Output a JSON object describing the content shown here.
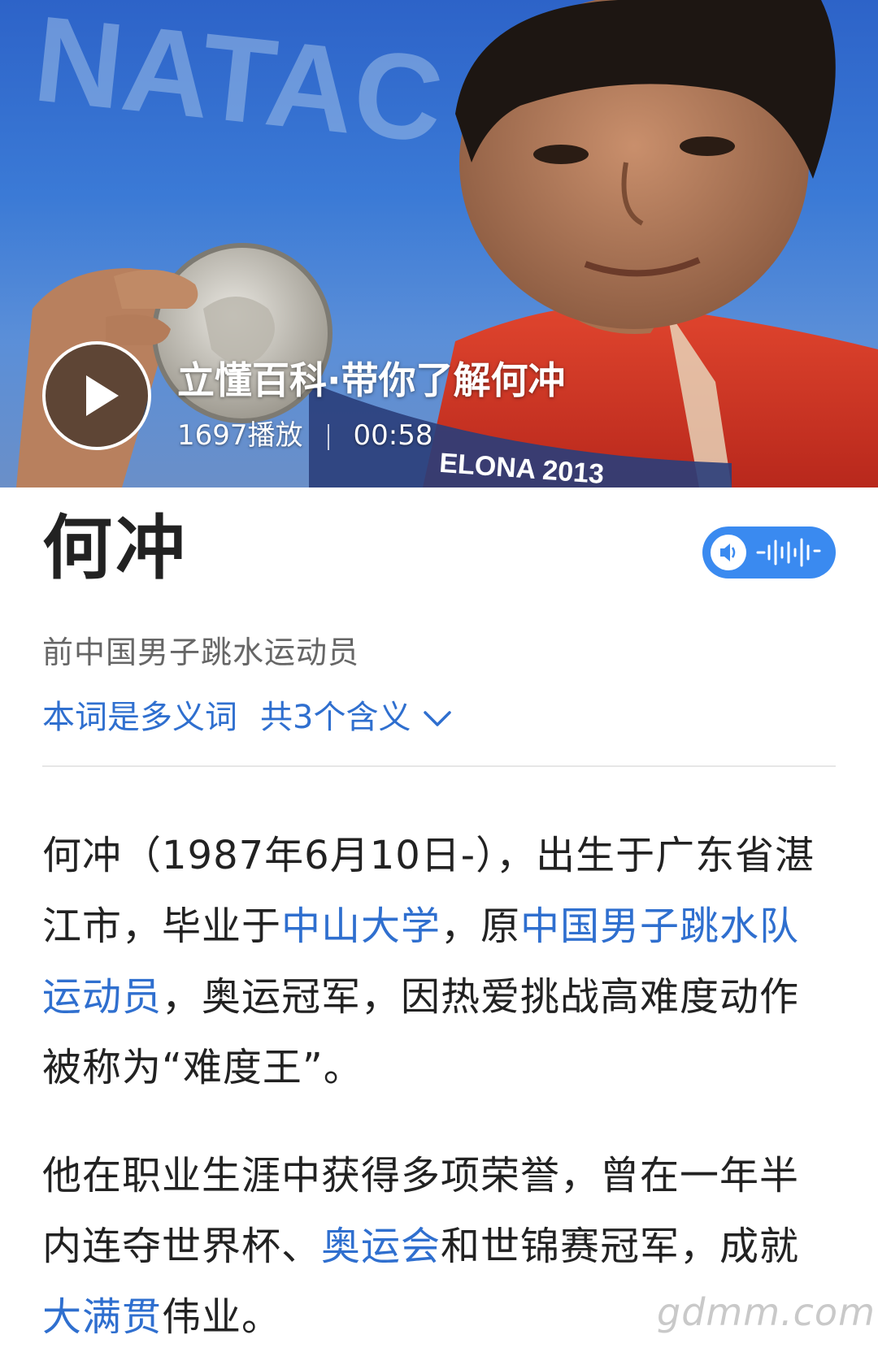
{
  "video": {
    "brand": "立懂百科",
    "title_suffix": "·带你了解何冲",
    "plays": "1697播放",
    "duration": "00:58",
    "medal_text": "ELONA 2013",
    "backdrop_text": "NATAC"
  },
  "entry": {
    "title": "何冲",
    "description": "前中国男子跳水运动员",
    "polysemy_label": "本词是多义词",
    "meanings_label": "共3个含义"
  },
  "paragraph1": {
    "t1": "何冲（1987年6月10日-），出生于广东省湛江市，毕业于",
    "link1": "中山大学",
    "t2": "，原",
    "link2": "中国男子跳水队运动员",
    "t3": "，奥运冠军，因热爱挑战高难度动作被称为“难度王”。"
  },
  "paragraph2": {
    "t1": "他在职业生涯中获得多项荣誉，曾在一年半内连夺世界杯、",
    "link1": "奥运会",
    "t2": "和世锦赛冠军，成就",
    "link2": "大满贯",
    "t3": "伟业。"
  },
  "watermark": "gdmm.com",
  "colors": {
    "link": "#2f6fcf",
    "audio_button": "#3a8af0",
    "title": "#222222"
  }
}
